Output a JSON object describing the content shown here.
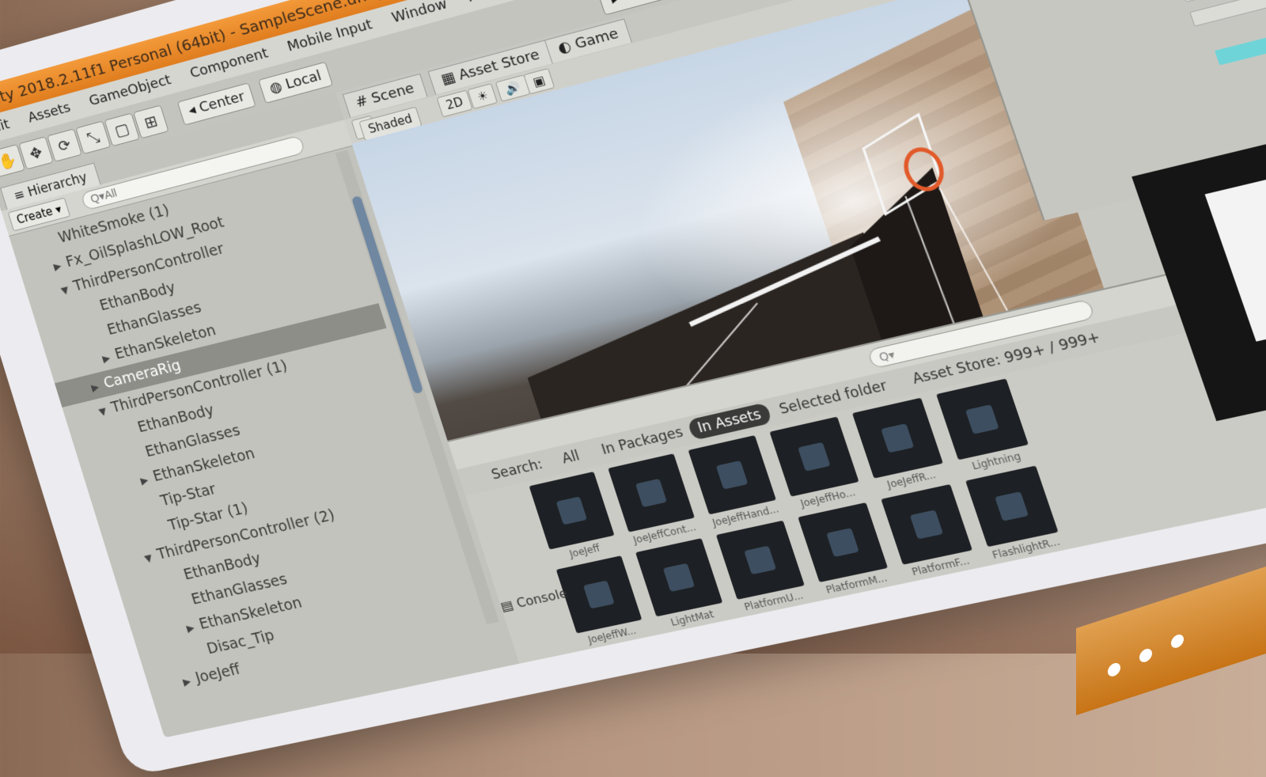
{
  "window": {
    "title": "Unity 2018.2.11f1 Personal (64bit) - SampleScene.unity - SCHOOL ESCAPE - PC, Mac & Linux Standalone"
  },
  "menu": [
    "Edit",
    "Assets",
    "GameObject",
    "Component",
    "Mobile Input",
    "Window",
    "Help"
  ],
  "toolbar": {
    "tools": [
      "hand-tool",
      "move-tool",
      "rotate-tool",
      "scale-tool",
      "rect-tool",
      "transform-tool"
    ],
    "pivot": "Center",
    "space": "Local",
    "play": "▶",
    "pause": "❚❚",
    "step": "▶❚"
  },
  "hierarchy": {
    "tab": "Hierarchy",
    "create": "Create",
    "search_placeholder": "Q▾All",
    "items": [
      {
        "label": "WhiteSmoke (1)",
        "indent": 1,
        "arrow": ""
      },
      {
        "label": "Fx_OilSplashLOW_Root",
        "indent": 1,
        "arrow": "▶"
      },
      {
        "label": "ThirdPersonController",
        "indent": 1,
        "arrow": "▼"
      },
      {
        "label": "EthanBody",
        "indent": 2,
        "arrow": ""
      },
      {
        "label": "EthanGlasses",
        "indent": 2,
        "arrow": ""
      },
      {
        "label": "EthanSkeleton",
        "indent": 2,
        "arrow": "▶"
      },
      {
        "label": "CameraRig",
        "indent": 1,
        "arrow": "▶",
        "selected": true
      },
      {
        "label": "ThirdPersonController (1)",
        "indent": 1,
        "arrow": "▼"
      },
      {
        "label": "EthanBody",
        "indent": 2,
        "arrow": ""
      },
      {
        "label": "EthanGlasses",
        "indent": 2,
        "arrow": ""
      },
      {
        "label": "EthanSkeleton",
        "indent": 2,
        "arrow": "▶"
      },
      {
        "label": "Tip-Star",
        "indent": 2,
        "arrow": ""
      },
      {
        "label": "Tip-Star (1)",
        "indent": 2,
        "arrow": ""
      },
      {
        "label": "ThirdPersonController (2)",
        "indent": 1,
        "arrow": "▼"
      },
      {
        "label": "EthanBody",
        "indent": 2,
        "arrow": ""
      },
      {
        "label": "EthanGlasses",
        "indent": 2,
        "arrow": ""
      },
      {
        "label": "EthanSkeleton",
        "indent": 2,
        "arrow": "▶"
      },
      {
        "label": "Disac_Tip",
        "indent": 2,
        "arrow": ""
      },
      {
        "label": "JoeJeff",
        "indent": 1,
        "arrow": "▶"
      }
    ]
  },
  "scene": {
    "tabs": [
      "Scene",
      "Asset Store",
      "Game"
    ],
    "shading": "Shaded",
    "mode_2d": "2D",
    "toggles": [
      "☀",
      "🔊",
      "▣"
    ]
  },
  "project": {
    "search_label": "Search:",
    "filters": [
      "All",
      "In Packages",
      "In Assets",
      "Selected folder",
      "Asset Store: 999+ / 999+"
    ],
    "active_filter": "In Assets",
    "assets": [
      "JoeJeff",
      "JoeJeffCont...",
      "JoeJeffHand...",
      "JoeJeffHo...",
      "JoeJeffR...",
      "Lightning",
      "JoeJeffW...",
      "LightMat",
      "PlatformU...",
      "PlatformM...",
      "PlatformF...",
      "FlashlightR..."
    ],
    "console_tab": "Console"
  },
  "colors": {
    "title_bar": "#e88a2a",
    "selection": "#8e8e88",
    "accent_teal": "#6fd4d8",
    "play_bg": "#e2e2dc"
  }
}
